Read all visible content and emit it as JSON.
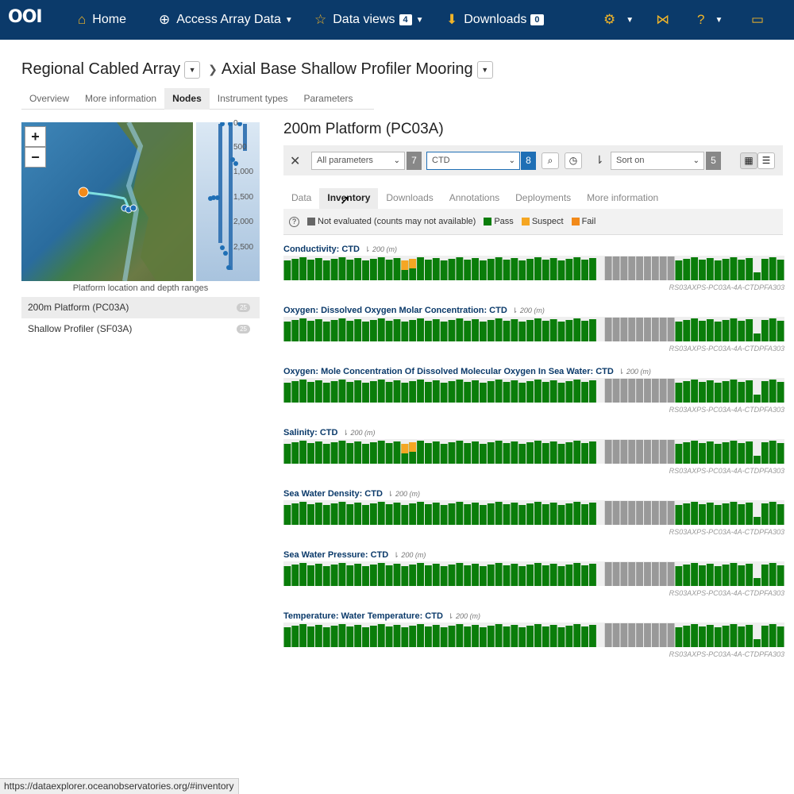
{
  "nav": {
    "logo": "OOI",
    "home": "Home",
    "access": "Access Array Data",
    "dataviews": "Data views",
    "dataviews_count": "4",
    "downloads": "Downloads",
    "downloads_count": "0"
  },
  "breadcrumb": {
    "array": "Regional Cabled Array",
    "site": "Axial Base Shallow Profiler Mooring"
  },
  "page_tabs": [
    "Overview",
    "More information",
    "Nodes",
    "Instrument types",
    "Parameters"
  ],
  "map": {
    "zoom_in": "+",
    "zoom_out": "−",
    "caption": "Platform location and depth ranges",
    "depth_ticks": [
      "0",
      "500",
      "1,000",
      "1,500",
      "2,000",
      "2,500"
    ]
  },
  "platforms": [
    {
      "label": "200m Platform (PC03A)",
      "count": "25"
    },
    {
      "label": "Shallow Profiler (SF03A)",
      "count": "25"
    }
  ],
  "right": {
    "title": "200m Platform (PC03A)"
  },
  "toolbar": {
    "param_select": "All parameters",
    "param_count": "7",
    "inst_select": "CTD",
    "inst_count": "8",
    "sort_select": "Sort on",
    "sort_count": "5"
  },
  "view_tabs": [
    "Data",
    "Inventory",
    "Downloads",
    "Annotations",
    "Deployments",
    "More information"
  ],
  "legend": {
    "not_evaluated": "Not evaluated (counts may not available)",
    "pass": "Pass",
    "suspect": "Suspect",
    "fail": "Fail"
  },
  "colors": {
    "pass": "#0a7d0a",
    "suspect": "#f5a623",
    "fail": "#f28a1a",
    "not_evaluated": "#999999"
  },
  "rows": [
    {
      "label": "Conductivity: CTD",
      "depth": "200 (m)",
      "ref": "RS03AXPS-PC03A-4A-CTDPFA303",
      "suspect": true
    },
    {
      "label": "Oxygen: Dissolved Oxygen Molar Concentration: CTD",
      "depth": "200 (m)",
      "ref": "RS03AXPS-PC03A-4A-CTDPFA303",
      "suspect": false
    },
    {
      "label": "Oxygen: Mole Concentration Of Dissolved Molecular Oxygen In Sea Water: CTD",
      "depth": "200 (m)",
      "ref": "RS03AXPS-PC03A-4A-CTDPFA303",
      "suspect": false
    },
    {
      "label": "Salinity: CTD",
      "depth": "200 (m)",
      "ref": "RS03AXPS-PC03A-4A-CTDPFA303",
      "suspect": true
    },
    {
      "label": "Sea Water Density: CTD",
      "depth": "200 (m)",
      "ref": "RS03AXPS-PC03A-4A-CTDPFA303",
      "suspect": false
    },
    {
      "label": "Sea Water Pressure: CTD",
      "depth": "200 (m)",
      "ref": "RS03AXPS-PC03A-4A-CTDPFA303",
      "suspect": false
    },
    {
      "label": "Temperature: Water Temperature: CTD",
      "depth": "200 (m)",
      "ref": "RS03AXPS-PC03A-4A-CTDPFA303",
      "suspect": false
    }
  ],
  "status_url": "https://dataexplorer.oceanobservatories.org/#inventory"
}
